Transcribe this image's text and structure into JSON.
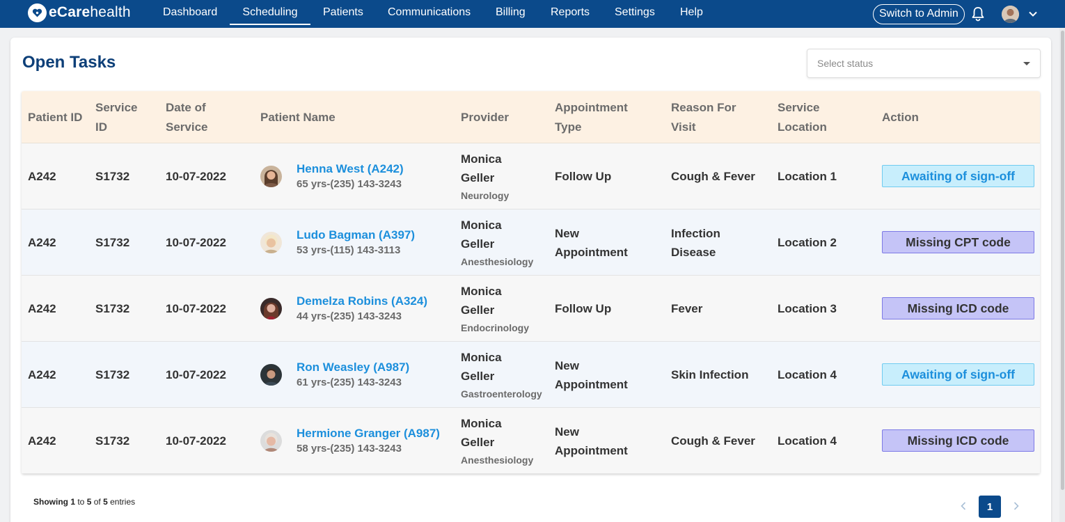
{
  "brand": {
    "name_bold": "eCare",
    "name_light": "health"
  },
  "nav": {
    "items": [
      "Dashboard",
      "Scheduling",
      "Patients",
      "Communications",
      "Billing",
      "Reports",
      "Settings",
      "Help"
    ],
    "active": "Scheduling",
    "switch_label": "Switch to Admin"
  },
  "icons": {
    "bell": "bell-icon",
    "user_menu": "chevron-down-icon",
    "brand": "heart-logo-icon"
  },
  "colors": {
    "nav_bg": "#0b4a8b",
    "title": "#0d3f78",
    "link": "#1c8fdc",
    "header_bg": "#fdf1e3",
    "awaiting_bg": "#c8eefc",
    "missing_bg": "#c5c4f7"
  },
  "page": {
    "title": "Open Tasks",
    "status_placeholder": "Select status"
  },
  "table": {
    "columns": [
      "Patient ID",
      "Service ID",
      "Date of Service",
      "Patient Name",
      "Provider",
      "Appointment Type",
      "Reason For Visit",
      "Service Location",
      "Action"
    ],
    "rows": [
      {
        "patient_id": "A242",
        "service_id": "S1732",
        "date": "10-07-2022",
        "patient_name": "Henna West (A242)",
        "patient_detail": "65 yrs-(235) 143-3243",
        "provider": "Monica Geller",
        "specialty": "Neurology",
        "appointment_type": "Follow Up",
        "reason": "Cough & Fever",
        "location": "Location 1",
        "action": "Awaiting of sign-off",
        "action_kind": "awaiting"
      },
      {
        "patient_id": "A242",
        "service_id": "S1732",
        "date": "10-07-2022",
        "patient_name": "Ludo Bagman (A397)",
        "patient_detail": "53 yrs-(115) 143-3113",
        "provider": "Monica Geller",
        "specialty": "Anesthesiology",
        "appointment_type": "New Appointment",
        "reason": "Infection Disease",
        "location": "Location 2",
        "action": "Missing CPT code",
        "action_kind": "missing"
      },
      {
        "patient_id": "A242",
        "service_id": "S1732",
        "date": "10-07-2022",
        "patient_name": "Demelza Robins (A324)",
        "patient_detail": "44 yrs-(235) 143-3243",
        "provider": "Monica Geller",
        "specialty": "Endocrinology",
        "appointment_type": "Follow Up",
        "reason": "Fever",
        "location": "Location 3",
        "action": "Missing ICD code",
        "action_kind": "missing"
      },
      {
        "patient_id": "A242",
        "service_id": "S1732",
        "date": "10-07-2022",
        "patient_name": "Ron Weasley (A987)",
        "patient_detail": "61 yrs-(235) 143-3243",
        "provider": "Monica Geller",
        "specialty": "Gastroenterology",
        "appointment_type": "New Appointment",
        "reason": "Skin Infection",
        "location": "Location 4",
        "action": "Awaiting of sign-off",
        "action_kind": "awaiting"
      },
      {
        "patient_id": "A242",
        "service_id": "S1732",
        "date": "10-07-2022",
        "patient_name": "Hermione Granger (A987)",
        "patient_detail": "58 yrs-(235) 143-3243",
        "provider": "Monica Geller",
        "specialty": "Anesthesiology",
        "appointment_type": "New Appointment",
        "reason": "Cough & Fever",
        "location": "Location 4",
        "action": "Missing ICD code",
        "action_kind": "missing"
      }
    ]
  },
  "footer": {
    "showing_prefix": "Showing ",
    "from": "1",
    "to_word": " to ",
    "to": "5",
    "of_word": " of ",
    "total": "5",
    "suffix": " entries",
    "current_page": "1"
  }
}
